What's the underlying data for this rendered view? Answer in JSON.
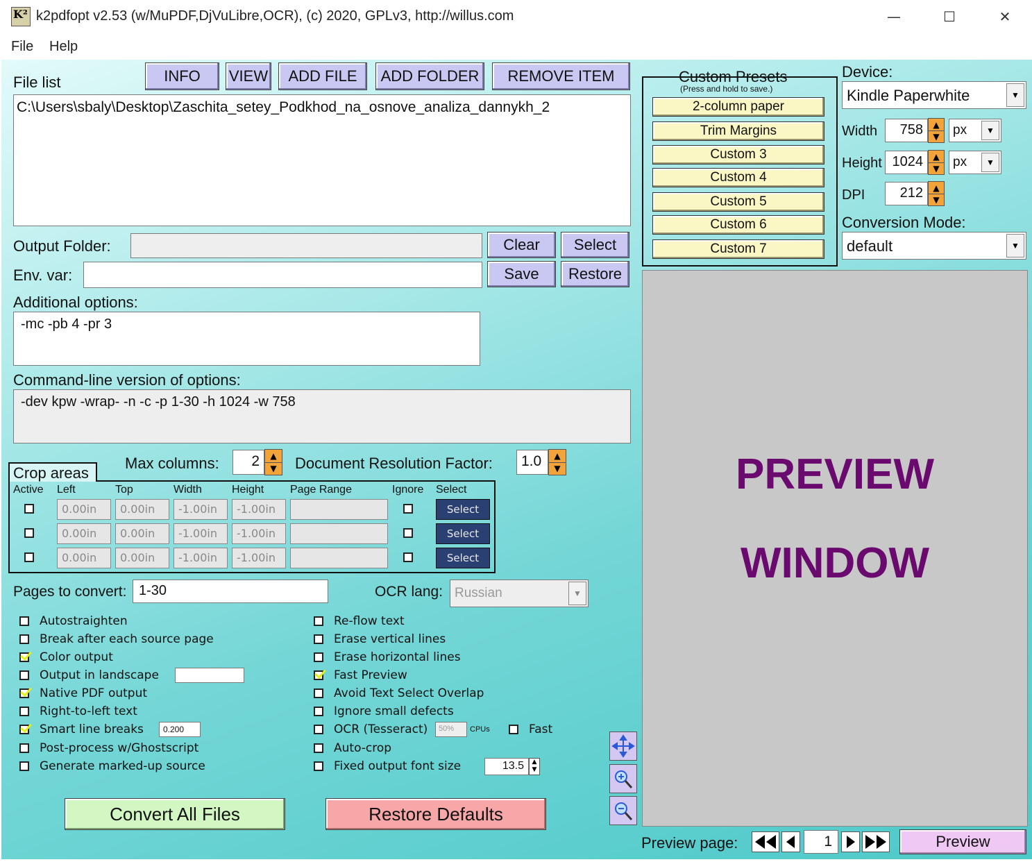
{
  "window": {
    "title": "k2pdfopt v2.53 (w/MuPDF,DjVuLibre,OCR), (c) 2020, GPLv3, http://willus.com",
    "logo": "K²",
    "minimize_glyph": "—",
    "maximize_glyph": "☐",
    "close_glyph": "✕"
  },
  "menu": {
    "file": "File",
    "help": "Help"
  },
  "file_list": {
    "label": "File list",
    "buttons": {
      "info": "INFO",
      "view": "VIEW",
      "add_file": "ADD FILE",
      "add_folder": "ADD FOLDER",
      "remove_item": "REMOVE ITEM"
    },
    "items": [
      "C:\\Users\\sbaly\\Desktop\\Zaschita_setey_Podkhod_na_osnove_analiza_dannykh_2"
    ]
  },
  "output_folder": {
    "label": "Output Folder:",
    "value": "",
    "clear": "Clear",
    "select": "Select"
  },
  "env_var": {
    "label": "Env. var:",
    "value": "",
    "save": "Save",
    "restore": "Restore"
  },
  "additional_options": {
    "label": "Additional options:",
    "value": "-mc -pb 4 -pr 3"
  },
  "command_line": {
    "label": "Command-line version of options:",
    "value": "-dev kpw -wrap- -n -c -p 1-30 -h 1024 -w 758"
  },
  "max_columns": {
    "label": "Max columns:",
    "value": "2"
  },
  "doc_resolution": {
    "label": "Document Resolution Factor:",
    "value": "1.0"
  },
  "crop_areas": {
    "label": "Crop areas",
    "headers": [
      "Active",
      "Left",
      "Top",
      "Width",
      "Height",
      "Page Range",
      "Ignore",
      "Select"
    ],
    "rows": [
      {
        "left": "0.00in",
        "top": "0.00in",
        "width": "-1.00in",
        "height": "-1.00in",
        "page_range": "",
        "select": "Select"
      },
      {
        "left": "0.00in",
        "top": "0.00in",
        "width": "-1.00in",
        "height": "-1.00in",
        "page_range": "",
        "select": "Select"
      },
      {
        "left": "0.00in",
        "top": "0.00in",
        "width": "-1.00in",
        "height": "-1.00in",
        "page_range": "",
        "select": "Select"
      }
    ]
  },
  "pages_to_convert": {
    "label": "Pages to convert:",
    "value": "1-30"
  },
  "ocr_lang": {
    "label": "OCR lang:",
    "value": "Russian"
  },
  "options_left": [
    {
      "label": "Autostraighten",
      "checked": false
    },
    {
      "label": "Break after each source page",
      "checked": false
    },
    {
      "label": "Color output",
      "checked": true
    },
    {
      "label": "Output in landscape",
      "checked": false
    },
    {
      "label": "Native PDF output",
      "checked": true
    },
    {
      "label": "Right-to-left text",
      "checked": false
    },
    {
      "label": "Smart line breaks",
      "checked": true
    },
    {
      "label": "Post-process w/Ghostscript",
      "checked": false
    },
    {
      "label": "Generate marked-up source",
      "checked": false
    }
  ],
  "options_right": [
    {
      "label": "Re-flow text",
      "checked": false
    },
    {
      "label": "Erase vertical lines",
      "checked": false
    },
    {
      "label": "Erase horizontal lines",
      "checked": false
    },
    {
      "label": "Fast Preview",
      "checked": true
    },
    {
      "label": "Avoid Text Select Overlap",
      "checked": false
    },
    {
      "label": "Ignore small defects",
      "checked": false
    },
    {
      "label": "OCR (Tesseract)",
      "checked": false
    },
    {
      "label": "Auto-crop",
      "checked": false
    },
    {
      "label": "Fixed output font size",
      "checked": false
    }
  ],
  "landscape_value": "",
  "smart_line_breaks_value": "0.200",
  "ocr_cpus": {
    "value": "50%",
    "label": "CPUs",
    "fast_label": "Fast",
    "fast_checked": false
  },
  "font_size_value": "13.5",
  "convert_button": "Convert All Files",
  "restore_defaults_button": "Restore Defaults",
  "custom_presets": {
    "title": "Custom Presets",
    "subtitle": "(Press and hold to save.)",
    "items": [
      "2-column paper",
      "Trim Margins",
      "Custom 3",
      "Custom 4",
      "Custom 5",
      "Custom 6",
      "Custom 7"
    ]
  },
  "device": {
    "label": "Device:",
    "value": "Kindle Paperwhite"
  },
  "width": {
    "label": "Width",
    "value": "758",
    "unit": "px"
  },
  "height": {
    "label": "Height",
    "value": "1024",
    "unit": "px"
  },
  "dpi": {
    "label": "DPI",
    "value": "212"
  },
  "conversion_mode": {
    "label": "Conversion Mode:",
    "value": "default"
  },
  "preview": {
    "line1": "PREVIEW",
    "line2": "WINDOW",
    "page_label": "Preview page:",
    "page_value": "1",
    "button": "Preview"
  },
  "colors": {
    "preview_text": "#6a0a6e",
    "button_bg": "#c8c8f2",
    "preset_bg": "#fbf7c4",
    "convert_bg": "#d2f7c2",
    "restore_bg": "#f7a7a7",
    "select_btn_bg": "#2a3f72",
    "spinner": "#f2a33a"
  }
}
